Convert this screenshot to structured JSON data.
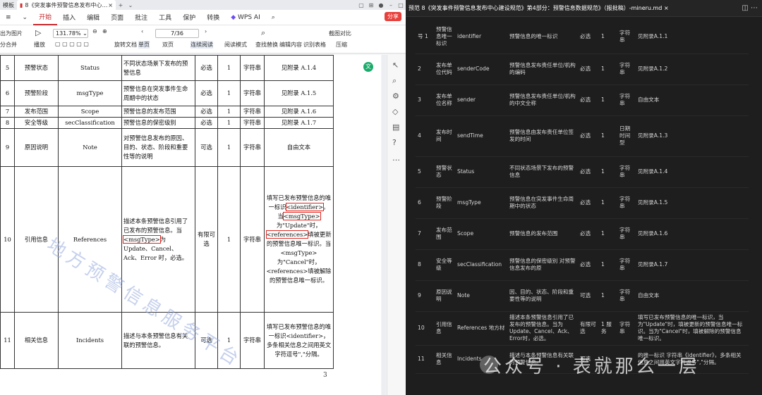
{
  "left_app": {
    "titlebar": {
      "tab_templates": "模板",
      "tab_doc": "8《突发事件预警信息发布中心…"
    },
    "menu": {
      "start": "开始",
      "insert": "插入",
      "edit": "编辑",
      "page": "页面",
      "annotate": "批注",
      "tools": "工具",
      "protect": "保护",
      "convert": "转换",
      "wps_ai": "WPS AI",
      "share": "分享"
    },
    "ribbon": {
      "export_image": "出为图片",
      "merge": "分合并",
      "play": "播放",
      "zoom_value": "131.78%",
      "rotate": "旋转文档",
      "single": "单页",
      "double": "双页",
      "continuous": "连续阅读",
      "read_mode": "阅读模式",
      "find_replace": "查找替换",
      "edit_content": "编辑内容",
      "recognize_table": "识别表格",
      "screenshot_compare": "截图对比",
      "compress": "压缩",
      "page_indicator": "7/36"
    },
    "table": {
      "rows": [
        {
          "no": "5",
          "name": "预警状态",
          "code": "Status",
          "desc": "不同状态场景下发布的预警信息",
          "req": "必选",
          "count": "1",
          "type": "字符串",
          "note": "见附录 A.1.4"
        },
        {
          "no": "6",
          "name": "预警阶段",
          "code": "msgType",
          "desc": "预警信息在突发事件生命周期中的状态",
          "req": "必选",
          "count": "1",
          "type": "字符串",
          "note": "见附录 A.1.5"
        },
        {
          "no": "7",
          "name": "发布范围",
          "code": "Scope",
          "desc": "预警信息的发布范围",
          "req": "必选",
          "count": "1",
          "type": "字符串",
          "note": "见附录 A.1.6"
        },
        {
          "no": "8",
          "name": "安全等级",
          "code": "secClassification",
          "desc": "预警信息的保密级别",
          "req": "必选",
          "count": "1",
          "type": "字符串",
          "note": "见附录 A.1.7"
        },
        {
          "no": "9",
          "name": "原因说明",
          "code": "Note",
          "desc": "对预警信息发布的原因、目的、状态、阶段和重要性等的说明",
          "req": "可选",
          "count": "1",
          "type": "字符串",
          "note": "自由文本"
        }
      ],
      "row10": {
        "no": "10",
        "name": "引用信息",
        "code": "References",
        "desc1": "描述本条预警信息引用了已发布的预警信息。当",
        "desc_mark": "<msgType>",
        "desc2": "为 Update、Cancel、Ack、Error 时，必选。",
        "req": "有限可选",
        "count": "1",
        "type": "字符串",
        "n1": "填写已发布预警信息的唯一标识",
        "n_id": "<identifier>",
        "n2": "。当",
        "n_msg": "<msgType>",
        "n3": "为\"Update\"时，",
        "n_ref": "<references>",
        "n4": "填被更新的预警信息唯一标识。当<msgType>为\"Cancel\"时，<references>填被解除的预警信息唯一标识。"
      },
      "row11": {
        "no": "11",
        "name": "相关信息",
        "code": "Incidents",
        "desc": "描述与本条预警信息有关联的预警信息。",
        "req": "可选",
        "count": "1",
        "type": "字符串",
        "note": "填写已发布预警信息的唯一标识<identifier>，多条相关信息之间用英文字符逗号\",\"分隔。"
      }
    },
    "watermark": "地方预警信息服务平台",
    "page_number": "3"
  },
  "right_app": {
    "tab_title": "预范 8《突发事件预警信息发布中心建设规范》第4部分：预警信息数据规范》（报批稿）-mineru.md",
    "rows": [
      {
        "no": "号 1",
        "name": "预警信息唯一标识",
        "code": "identifier",
        "desc": "预警信息的唯一标识",
        "req": "必选",
        "count": "1",
        "type": "字符串",
        "note": "见附录A.1.1"
      },
      {
        "no": "2",
        "name": "发布单位代码",
        "code": "senderCode",
        "desc": "预警信息发布责任单位/机构的编码",
        "req": "必选",
        "count": "1",
        "type": "字符串",
        "note": "见附录A.1.2"
      },
      {
        "no": "3",
        "name": "发布单位名称",
        "code": "sender",
        "desc": "预警信息发布责任单位/机构的中文全称",
        "req": "必选",
        "count": "1",
        "type": "字符串",
        "note": "自由文本"
      },
      {
        "no": "4",
        "name": "发布时间",
        "code": "sendTime",
        "desc": "预警信息由发布责任单位签发的时间",
        "req": "必选",
        "count": "1",
        "type": "日期时间型",
        "note": "见附录A.1.3"
      },
      {
        "no": "5",
        "name": "预警状态",
        "code": "Status",
        "desc": "不同状态场景下发布的预警信息",
        "req": "必选",
        "count": "1",
        "type": "字符串",
        "note": "见附录A.1.4"
      },
      {
        "no": "6",
        "name": "预警阶段",
        "code": "msgType",
        "desc": "预警信息在突发事件生命周期中的状态",
        "req": "必选",
        "count": "1",
        "type": "字符串",
        "note": "见附录A.1.5"
      },
      {
        "no": "7",
        "name": "发布范围",
        "code": "Scope",
        "desc": "预警信息的发布范围",
        "req": "必选",
        "count": "1",
        "type": "字符串",
        "note": "见附录A.1.6"
      },
      {
        "no": "8",
        "name": "安全等级",
        "code": "secClassification",
        "desc": "预警信息的保密级别 对预警信息发布的原",
        "req": "必选",
        "count": "1",
        "type": "字符串",
        "note": "见附录A.1.7"
      },
      {
        "no": "9",
        "name": "原因说明",
        "code": "Note",
        "desc": "因、目的、状态、阶段和重要性等的说明",
        "req": "可选",
        "count": "1",
        "type": "字符串",
        "note": "自由文本"
      },
      {
        "no": "10",
        "name": "引用信息",
        "code": "References 地方材",
        "desc": "描述本条预警信息引用了已发布的预警信息。当为 Update、Cancel、Ack、Error时，必选。",
        "req": "有限可选",
        "count": "1 服务",
        "type": "字符串",
        "note": "填写已发布预警信息的唯一标识，当为\"Update\"时，填被更新的预警信息唯一标识。当为\"Cancel\"时，填被解除的预警信息唯一标识。"
      },
      {
        "no": "11",
        "name": "相关信息",
        "code": "Incidents",
        "desc": "描述与本条预警信息有关联的预警信息。",
        "req": "可选",
        "count": "1",
        "type": "",
        "note": "的唯一标识 字符串《identifier》，多条相关信息之间用英文字符逗号\",\"分隔。"
      }
    ],
    "watermark": "公众号 · 表就那么一层"
  }
}
